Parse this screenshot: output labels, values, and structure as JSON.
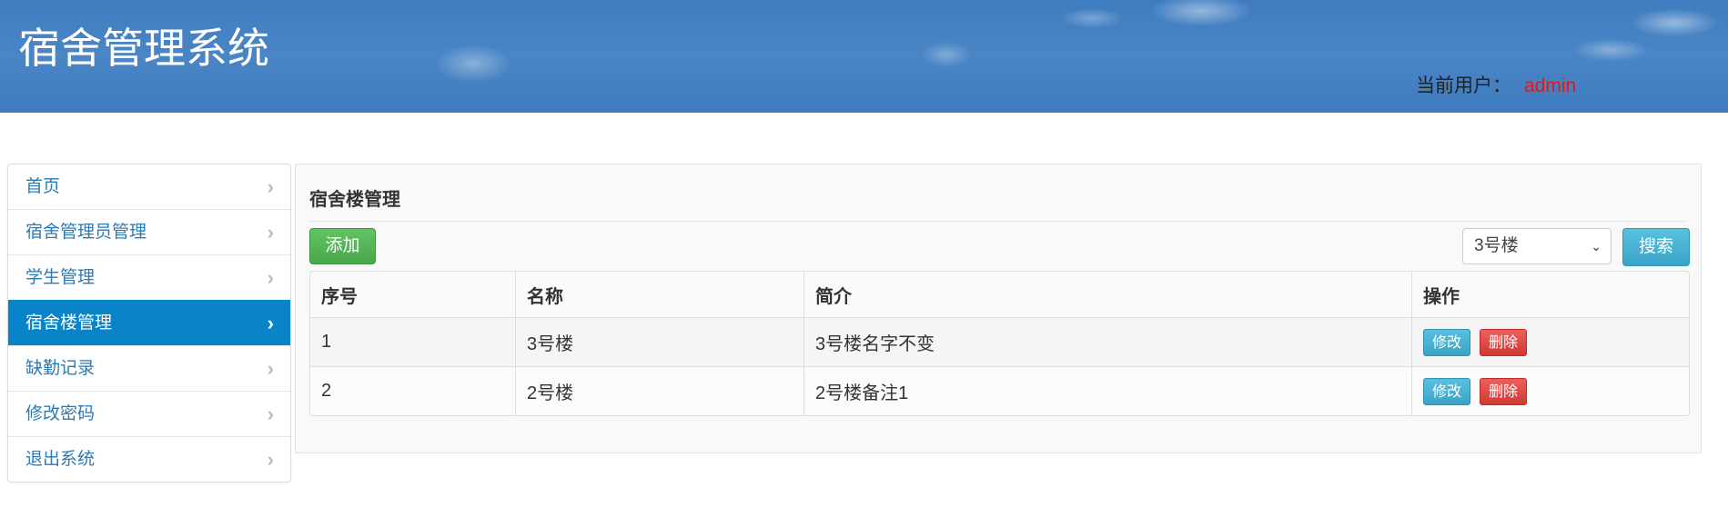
{
  "header": {
    "app_title": "宿舍管理系统",
    "current_user_label": "当前用户：",
    "current_user_name": "admin"
  },
  "sidebar": {
    "items": [
      {
        "label": "首页"
      },
      {
        "label": "宿舍管理员管理"
      },
      {
        "label": "学生管理"
      },
      {
        "label": "宿舍楼管理",
        "active": true
      },
      {
        "label": "缺勤记录"
      },
      {
        "label": "修改密码"
      },
      {
        "label": "退出系统"
      }
    ]
  },
  "main": {
    "title": "宿舍楼管理",
    "add_label": "添加",
    "filter_selected": "3号楼",
    "search_label": "搜索",
    "table": {
      "headers": [
        "序号",
        "名称",
        "简介",
        "操作"
      ],
      "rows": [
        {
          "index": "1",
          "name": "3号楼",
          "desc": "3号楼名字不变",
          "edit": "修改",
          "delete": "删除"
        },
        {
          "index": "2",
          "name": "2号楼",
          "desc": "2号楼备注1",
          "edit": "修改",
          "delete": "删除"
        }
      ]
    }
  },
  "colors": {
    "header_bg": "#4a86c6",
    "active_nav": "#0a84c8",
    "success": "#5cb85c",
    "info": "#5bc0de",
    "danger": "#d9534f",
    "user_name": "#e01818"
  },
  "icons": {
    "nav_chevron": "chevron-right-icon",
    "select_arrow": "chevron-down-icon"
  }
}
